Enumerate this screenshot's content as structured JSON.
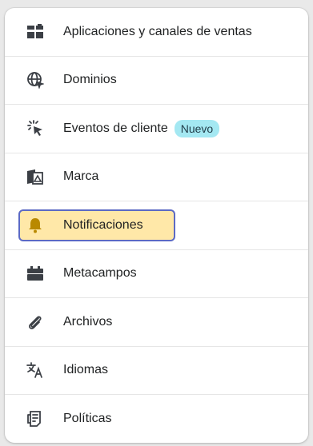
{
  "menu": {
    "items": [
      {
        "label": "Aplicaciones y canales de ventas",
        "icon": "apps-icon"
      },
      {
        "label": "Dominios",
        "icon": "globe-icon"
      },
      {
        "label": "Eventos de cliente",
        "icon": "cursor-click-icon",
        "badge": "Nuevo"
      },
      {
        "label": "Marca",
        "icon": "brand-image-icon"
      },
      {
        "label": "Notificaciones",
        "icon": "bell-icon",
        "selected": true
      },
      {
        "label": "Metacampos",
        "icon": "metafields-icon"
      },
      {
        "label": "Archivos",
        "icon": "paperclip-icon"
      },
      {
        "label": "Idiomas",
        "icon": "translate-icon"
      },
      {
        "label": "Políticas",
        "icon": "policy-document-icon"
      }
    ]
  },
  "colors": {
    "highlight_bg": "#ffe8a8",
    "highlight_border": "#5c6ac4",
    "badge_bg": "#a4e8f2",
    "icon": "#3b3f45",
    "bell": "#b98900"
  }
}
